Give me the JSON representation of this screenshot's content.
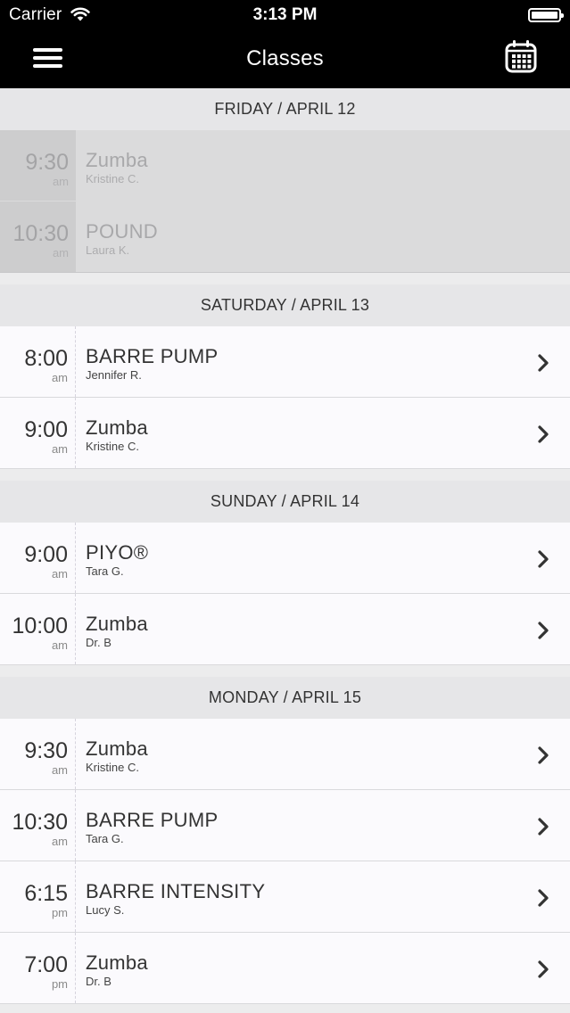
{
  "status_bar": {
    "carrier": "Carrier",
    "time": "3:13 PM"
  },
  "nav": {
    "title": "Classes",
    "menu_icon": "hamburger-menu-icon",
    "calendar_icon": "calendar-icon"
  },
  "colors": {
    "nav_background": "#000000",
    "header_background": "#e6e6e8",
    "row_background": "#fbfafd",
    "past_row_background": "#dbdbdc"
  },
  "days": [
    {
      "header": "FRIDAY / APRIL 12",
      "classes": [
        {
          "time": "9:30",
          "ampm": "am",
          "name": "Zumba",
          "instructor": "Kristine C.",
          "past": true
        },
        {
          "time": "10:30",
          "ampm": "am",
          "name": "POUND",
          "instructor": "Laura K.",
          "past": true
        }
      ]
    },
    {
      "header": "SATURDAY / APRIL 13",
      "classes": [
        {
          "time": "8:00",
          "ampm": "am",
          "name": "BARRE PUMP",
          "instructor": "Jennifer R.",
          "past": false
        },
        {
          "time": "9:00",
          "ampm": "am",
          "name": "Zumba",
          "instructor": "Kristine C.",
          "past": false
        }
      ]
    },
    {
      "header": "SUNDAY / APRIL 14",
      "classes": [
        {
          "time": "9:00",
          "ampm": "am",
          "name": "PIYO®",
          "instructor": "Tara G.",
          "past": false
        },
        {
          "time": "10:00",
          "ampm": "am",
          "name": "Zumba",
          "instructor": "Dr. B",
          "past": false
        }
      ]
    },
    {
      "header": "MONDAY / APRIL 15",
      "classes": [
        {
          "time": "9:30",
          "ampm": "am",
          "name": "Zumba",
          "instructor": "Kristine C.",
          "past": false
        },
        {
          "time": "10:30",
          "ampm": "am",
          "name": "BARRE PUMP",
          "instructor": "Tara G.",
          "past": false
        },
        {
          "time": "6:15",
          "ampm": "pm",
          "name": "BARRE INTENSITY",
          "instructor": "Lucy S.",
          "past": false
        },
        {
          "time": "7:00",
          "ampm": "pm",
          "name": "Zumba",
          "instructor": "Dr. B",
          "past": false
        }
      ]
    }
  ]
}
